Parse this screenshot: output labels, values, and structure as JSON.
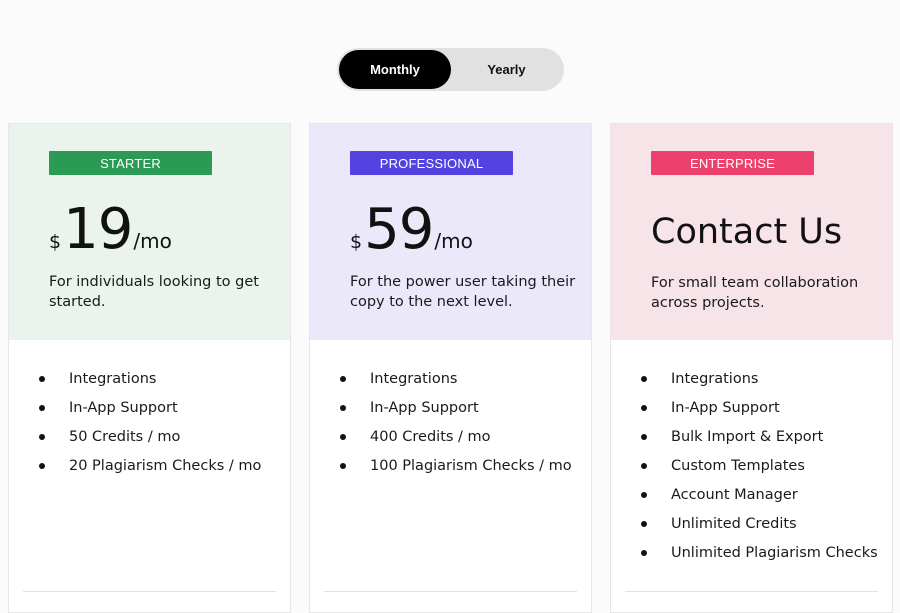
{
  "billing_toggle": {
    "monthly_label": "Monthly",
    "yearly_label": "Yearly",
    "selected": "Monthly"
  },
  "plans": [
    {
      "badge": "STARTER",
      "badge_color": "#2b9a55",
      "background_color": "#eaf3ec",
      "currency": "$",
      "amount": "19",
      "period": "/mo",
      "description": "For individuals looking to get started.",
      "features": [
        "Integrations",
        "In-App Support",
        "50 Credits / mo",
        "20 Plagiarism Checks / mo"
      ]
    },
    {
      "badge": "PROFESSIONAL",
      "badge_color": "#5442e0",
      "background_color": "#ebe8f9",
      "currency": "$",
      "amount": "59",
      "period": "/mo",
      "description": "For the power user taking their copy to the next level.",
      "features": [
        "Integrations",
        "In-App Support",
        "400 Credits / mo",
        "100 Plagiarism Checks / mo"
      ]
    },
    {
      "badge": "ENTERPRISE",
      "badge_color": "#ec416d",
      "background_color": "#f7e4e9",
      "price_text": "Contact Us",
      "description": "For small team collaboration across projects.",
      "features": [
        "Integrations",
        "In-App Support",
        "Bulk Import & Export",
        "Custom Templates",
        "Account Manager",
        "Unlimited Credits",
        "Unlimited Plagiarism Checks"
      ]
    }
  ]
}
